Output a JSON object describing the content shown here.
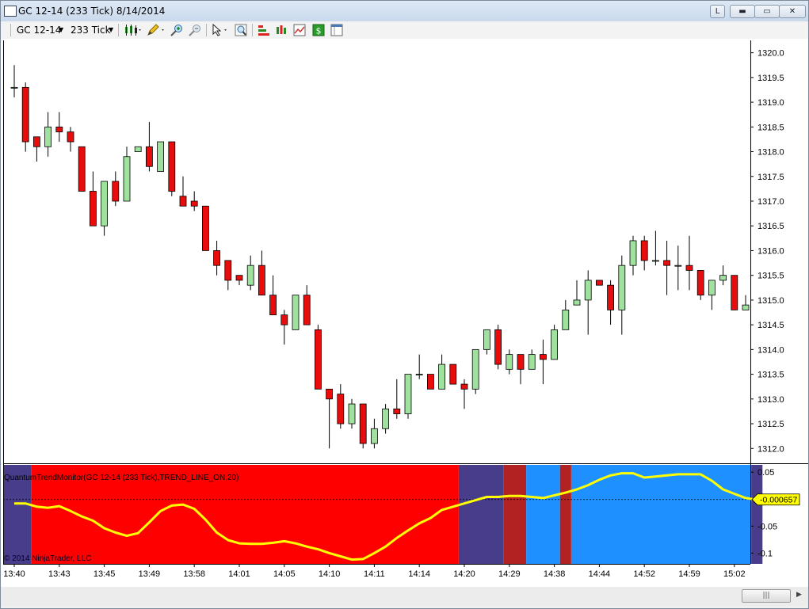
{
  "window": {
    "title": "GC 12-14 (233 Tick)  8/14/2014",
    "buttons": {
      "pin": "L",
      "minimize": "▬",
      "maximize": "▭",
      "close": "✕"
    }
  },
  "toolbar": {
    "instrument": "GC 12-14",
    "interval": "233 Tick",
    "icons": [
      "bar-type-icon",
      "pencil-draw-icon",
      "zoom-in-icon",
      "zoom-out-icon",
      "cursor-pointer-icon",
      "search-zoom-icon",
      "indicators-icon",
      "strategies-icon",
      "chart-properties-icon",
      "dollar-icon",
      "data-box-icon"
    ]
  },
  "indicator": {
    "label": "QuantumTrendMonitor(GC 12-14 (233 Tick),TREND_LINE_ON,20)",
    "current_value": "-0.000657"
  },
  "copyright": "© 2014 NinjaTrader, LLC",
  "colors": {
    "bull": "#9ee29e",
    "bear": "#e80c0c",
    "trend_line": "#ffff00",
    "zone_red": "#ff0000",
    "zone_darkred": "#b22222",
    "zone_blue": "#1e90ff",
    "zone_purple": "#483d8b"
  },
  "chart_data": [
    {
      "type": "candlestick",
      "price_axis": {
        "ylim": [
          1311.7,
          1320.25
        ],
        "tick_labels": [
          "1320.0",
          "1319.5",
          "1319.0",
          "1318.5",
          "1318.0",
          "1317.5",
          "1317.0",
          "1316.5",
          "1316.0",
          "1315.5",
          "1315.0",
          "1314.5",
          "1314.0",
          "1313.5",
          "1313.0",
          "1312.5",
          "1312.0"
        ]
      },
      "time_axis": {
        "tick_labels": [
          "13:40",
          "13:43",
          "13:45",
          "13:49",
          "13:58",
          "14:01",
          "14:05",
          "14:10",
          "14:11",
          "14:14",
          "14:20",
          "14:29",
          "14:38",
          "14:44",
          "14:52",
          "14:59",
          "15:02"
        ]
      },
      "bars": [
        {
          "o": 1319.3,
          "h": 1319.75,
          "l": 1319.1,
          "c": 1319.3
        },
        {
          "o": 1319.3,
          "h": 1319.4,
          "l": 1318.0,
          "c": 1318.2
        },
        {
          "o": 1318.3,
          "h": 1318.3,
          "l": 1317.8,
          "c": 1318.1
        },
        {
          "o": 1318.1,
          "h": 1318.8,
          "l": 1317.9,
          "c": 1318.5
        },
        {
          "o": 1318.5,
          "h": 1318.8,
          "l": 1318.2,
          "c": 1318.4
        },
        {
          "o": 1318.4,
          "h": 1318.5,
          "l": 1318.0,
          "c": 1318.2
        },
        {
          "o": 1318.1,
          "h": 1318.1,
          "l": 1317.2,
          "c": 1317.2
        },
        {
          "o": 1317.2,
          "h": 1317.6,
          "l": 1316.5,
          "c": 1316.5
        },
        {
          "o": 1316.5,
          "h": 1317.4,
          "l": 1316.3,
          "c": 1317.4
        },
        {
          "o": 1317.4,
          "h": 1317.6,
          "l": 1316.9,
          "c": 1317.0
        },
        {
          "o": 1317.0,
          "h": 1318.1,
          "l": 1317.0,
          "c": 1317.9
        },
        {
          "o": 1318.0,
          "h": 1318.1,
          "l": 1318.0,
          "c": 1318.1
        },
        {
          "o": 1318.1,
          "h": 1318.6,
          "l": 1317.6,
          "c": 1317.7
        },
        {
          "o": 1317.6,
          "h": 1318.2,
          "l": 1317.6,
          "c": 1318.2
        },
        {
          "o": 1318.2,
          "h": 1318.2,
          "l": 1317.1,
          "c": 1317.2
        },
        {
          "o": 1317.1,
          "h": 1317.5,
          "l": 1316.9,
          "c": 1316.9
        },
        {
          "o": 1317.0,
          "h": 1317.2,
          "l": 1316.8,
          "c": 1316.9
        },
        {
          "o": 1316.9,
          "h": 1316.9,
          "l": 1316.0,
          "c": 1316.0
        },
        {
          "o": 1316.0,
          "h": 1316.2,
          "l": 1315.5,
          "c": 1315.7
        },
        {
          "o": 1315.8,
          "h": 1315.8,
          "l": 1315.2,
          "c": 1315.4
        },
        {
          "o": 1315.5,
          "h": 1315.5,
          "l": 1315.3,
          "c": 1315.4
        },
        {
          "o": 1315.3,
          "h": 1315.9,
          "l": 1315.2,
          "c": 1315.7
        },
        {
          "o": 1315.7,
          "h": 1316.0,
          "l": 1315.1,
          "c": 1315.1
        },
        {
          "o": 1315.1,
          "h": 1315.5,
          "l": 1314.7,
          "c": 1314.7
        },
        {
          "o": 1314.7,
          "h": 1314.8,
          "l": 1314.1,
          "c": 1314.5
        },
        {
          "o": 1314.4,
          "h": 1315.1,
          "l": 1314.4,
          "c": 1315.1
        },
        {
          "o": 1315.1,
          "h": 1315.3,
          "l": 1314.5,
          "c": 1314.5
        },
        {
          "o": 1314.4,
          "h": 1314.5,
          "l": 1313.2,
          "c": 1313.2
        },
        {
          "o": 1313.2,
          "h": 1313.2,
          "l": 1312.0,
          "c": 1313.0
        },
        {
          "o": 1313.1,
          "h": 1313.3,
          "l": 1312.4,
          "c": 1312.5
        },
        {
          "o": 1312.5,
          "h": 1313.0,
          "l": 1312.4,
          "c": 1312.9
        },
        {
          "o": 1312.9,
          "h": 1312.9,
          "l": 1312.0,
          "c": 1312.1
        },
        {
          "o": 1312.1,
          "h": 1312.6,
          "l": 1312.0,
          "c": 1312.4
        },
        {
          "o": 1312.4,
          "h": 1312.9,
          "l": 1312.3,
          "c": 1312.8
        },
        {
          "o": 1312.8,
          "h": 1313.4,
          "l": 1312.6,
          "c": 1312.7
        },
        {
          "o": 1312.7,
          "h": 1313.5,
          "l": 1312.6,
          "c": 1313.5
        },
        {
          "o": 1313.5,
          "h": 1313.9,
          "l": 1313.4,
          "c": 1313.5
        },
        {
          "o": 1313.5,
          "h": 1313.5,
          "l": 1313.2,
          "c": 1313.2
        },
        {
          "o": 1313.2,
          "h": 1313.9,
          "l": 1313.2,
          "c": 1313.7
        },
        {
          "o": 1313.7,
          "h": 1313.7,
          "l": 1313.3,
          "c": 1313.3
        },
        {
          "o": 1313.3,
          "h": 1313.4,
          "l": 1312.8,
          "c": 1313.2
        },
        {
          "o": 1313.2,
          "h": 1314.0,
          "l": 1313.1,
          "c": 1314.0
        },
        {
          "o": 1314.0,
          "h": 1314.4,
          "l": 1313.9,
          "c": 1314.4
        },
        {
          "o": 1314.4,
          "h": 1314.5,
          "l": 1313.6,
          "c": 1313.7
        },
        {
          "o": 1313.6,
          "h": 1314.0,
          "l": 1313.5,
          "c": 1313.9
        },
        {
          "o": 1313.9,
          "h": 1313.9,
          "l": 1313.3,
          "c": 1313.6
        },
        {
          "o": 1313.6,
          "h": 1314.0,
          "l": 1313.6,
          "c": 1313.9
        },
        {
          "o": 1313.9,
          "h": 1314.2,
          "l": 1313.3,
          "c": 1313.8
        },
        {
          "o": 1313.8,
          "h": 1314.5,
          "l": 1313.8,
          "c": 1314.4
        },
        {
          "o": 1314.4,
          "h": 1315.0,
          "l": 1314.4,
          "c": 1314.8
        },
        {
          "o": 1314.9,
          "h": 1315.4,
          "l": 1314.9,
          "c": 1315.0
        },
        {
          "o": 1315.0,
          "h": 1315.6,
          "l": 1314.3,
          "c": 1315.4
        },
        {
          "o": 1315.4,
          "h": 1315.4,
          "l": 1315.3,
          "c": 1315.3
        },
        {
          "o": 1315.3,
          "h": 1315.4,
          "l": 1314.5,
          "c": 1314.8
        },
        {
          "o": 1314.8,
          "h": 1315.9,
          "l": 1314.3,
          "c": 1315.7
        },
        {
          "o": 1315.7,
          "h": 1316.3,
          "l": 1315.5,
          "c": 1316.2
        },
        {
          "o": 1316.2,
          "h": 1316.3,
          "l": 1315.6,
          "c": 1315.8
        },
        {
          "o": 1315.8,
          "h": 1316.4,
          "l": 1315.7,
          "c": 1315.8
        },
        {
          "o": 1315.8,
          "h": 1316.2,
          "l": 1315.1,
          "c": 1315.7
        },
        {
          "o": 1315.7,
          "h": 1316.1,
          "l": 1315.2,
          "c": 1315.7
        },
        {
          "o": 1315.7,
          "h": 1316.3,
          "l": 1315.2,
          "c": 1315.6
        },
        {
          "o": 1315.6,
          "h": 1315.6,
          "l": 1315.0,
          "c": 1315.1
        },
        {
          "o": 1315.1,
          "h": 1315.4,
          "l": 1314.8,
          "c": 1315.4
        },
        {
          "o": 1315.4,
          "h": 1315.7,
          "l": 1315.3,
          "c": 1315.5
        },
        {
          "o": 1315.5,
          "h": 1315.5,
          "l": 1314.8,
          "c": 1314.8
        },
        {
          "o": 1314.8,
          "h": 1315.1,
          "l": 1314.8,
          "c": 1314.9
        }
      ]
    },
    {
      "type": "line",
      "name": "QuantumTrendMonitor",
      "ylim": [
        -0.12,
        0.065
      ],
      "tick_labels": [
        "0.05",
        "-0.05",
        "-0.1"
      ],
      "tick_values": [
        0.05,
        -0.05,
        -0.1
      ],
      "last_value": -0.000657,
      "values": [
        -0.008,
        -0.008,
        -0.014,
        -0.016,
        -0.013,
        -0.022,
        -0.032,
        -0.04,
        -0.054,
        -0.062,
        -0.068,
        -0.063,
        -0.043,
        -0.022,
        -0.012,
        -0.01,
        -0.018,
        -0.038,
        -0.062,
        -0.076,
        -0.082,
        -0.083,
        -0.083,
        -0.081,
        -0.078,
        -0.082,
        -0.088,
        -0.093,
        -0.1,
        -0.106,
        -0.112,
        -0.111,
        -0.1,
        -0.088,
        -0.072,
        -0.058,
        -0.045,
        -0.035,
        -0.02,
        -0.014,
        -0.008,
        -0.002,
        0.004,
        0.004,
        0.006,
        0.006,
        0.004,
        0.002,
        0.007,
        0.012,
        0.018,
        0.026,
        0.036,
        0.044,
        0.048,
        0.048,
        0.04,
        0.042,
        0.044,
        0.046,
        0.046,
        0.046,
        0.034,
        0.018,
        0.01,
        0.002,
        -0.001
      ],
      "zones": [
        {
          "from": 0,
          "to": 1,
          "color": "purple"
        },
        {
          "from": 2,
          "to": 39,
          "color": "red"
        },
        {
          "from": 40,
          "to": 43,
          "color": "purple"
        },
        {
          "from": 44,
          "to": 45,
          "color": "darkred"
        },
        {
          "from": 46,
          "to": 48,
          "color": "blue"
        },
        {
          "from": 49,
          "to": 49,
          "color": "darkred"
        },
        {
          "from": 50,
          "to": 65,
          "color": "blue"
        },
        {
          "from": 66,
          "to": 66,
          "color": "purple"
        }
      ]
    }
  ]
}
